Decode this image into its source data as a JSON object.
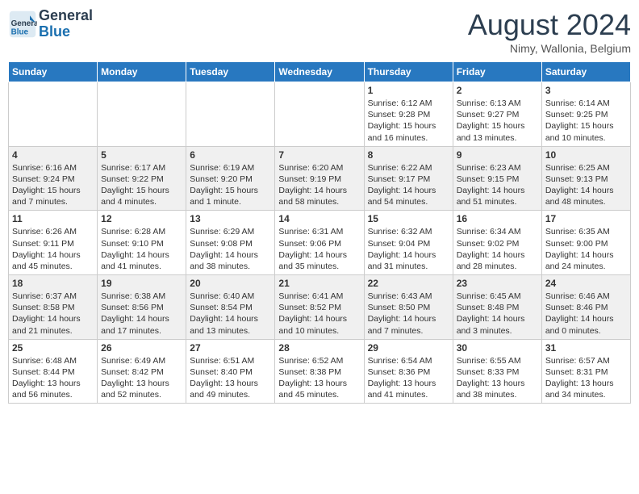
{
  "header": {
    "logo_line1": "General",
    "logo_line2": "Blue",
    "month_title": "August 2024",
    "location": "Nimy, Wallonia, Belgium"
  },
  "weekdays": [
    "Sunday",
    "Monday",
    "Tuesday",
    "Wednesday",
    "Thursday",
    "Friday",
    "Saturday"
  ],
  "weeks": [
    [
      {
        "day": "",
        "info": ""
      },
      {
        "day": "",
        "info": ""
      },
      {
        "day": "",
        "info": ""
      },
      {
        "day": "",
        "info": ""
      },
      {
        "day": "1",
        "info": "Sunrise: 6:12 AM\nSunset: 9:28 PM\nDaylight: 15 hours\nand 16 minutes."
      },
      {
        "day": "2",
        "info": "Sunrise: 6:13 AM\nSunset: 9:27 PM\nDaylight: 15 hours\nand 13 minutes."
      },
      {
        "day": "3",
        "info": "Sunrise: 6:14 AM\nSunset: 9:25 PM\nDaylight: 15 hours\nand 10 minutes."
      }
    ],
    [
      {
        "day": "4",
        "info": "Sunrise: 6:16 AM\nSunset: 9:24 PM\nDaylight: 15 hours\nand 7 minutes."
      },
      {
        "day": "5",
        "info": "Sunrise: 6:17 AM\nSunset: 9:22 PM\nDaylight: 15 hours\nand 4 minutes."
      },
      {
        "day": "6",
        "info": "Sunrise: 6:19 AM\nSunset: 9:20 PM\nDaylight: 15 hours\nand 1 minute."
      },
      {
        "day": "7",
        "info": "Sunrise: 6:20 AM\nSunset: 9:19 PM\nDaylight: 14 hours\nand 58 minutes."
      },
      {
        "day": "8",
        "info": "Sunrise: 6:22 AM\nSunset: 9:17 PM\nDaylight: 14 hours\nand 54 minutes."
      },
      {
        "day": "9",
        "info": "Sunrise: 6:23 AM\nSunset: 9:15 PM\nDaylight: 14 hours\nand 51 minutes."
      },
      {
        "day": "10",
        "info": "Sunrise: 6:25 AM\nSunset: 9:13 PM\nDaylight: 14 hours\nand 48 minutes."
      }
    ],
    [
      {
        "day": "11",
        "info": "Sunrise: 6:26 AM\nSunset: 9:11 PM\nDaylight: 14 hours\nand 45 minutes."
      },
      {
        "day": "12",
        "info": "Sunrise: 6:28 AM\nSunset: 9:10 PM\nDaylight: 14 hours\nand 41 minutes."
      },
      {
        "day": "13",
        "info": "Sunrise: 6:29 AM\nSunset: 9:08 PM\nDaylight: 14 hours\nand 38 minutes."
      },
      {
        "day": "14",
        "info": "Sunrise: 6:31 AM\nSunset: 9:06 PM\nDaylight: 14 hours\nand 35 minutes."
      },
      {
        "day": "15",
        "info": "Sunrise: 6:32 AM\nSunset: 9:04 PM\nDaylight: 14 hours\nand 31 minutes."
      },
      {
        "day": "16",
        "info": "Sunrise: 6:34 AM\nSunset: 9:02 PM\nDaylight: 14 hours\nand 28 minutes."
      },
      {
        "day": "17",
        "info": "Sunrise: 6:35 AM\nSunset: 9:00 PM\nDaylight: 14 hours\nand 24 minutes."
      }
    ],
    [
      {
        "day": "18",
        "info": "Sunrise: 6:37 AM\nSunset: 8:58 PM\nDaylight: 14 hours\nand 21 minutes."
      },
      {
        "day": "19",
        "info": "Sunrise: 6:38 AM\nSunset: 8:56 PM\nDaylight: 14 hours\nand 17 minutes."
      },
      {
        "day": "20",
        "info": "Sunrise: 6:40 AM\nSunset: 8:54 PM\nDaylight: 14 hours\nand 13 minutes."
      },
      {
        "day": "21",
        "info": "Sunrise: 6:41 AM\nSunset: 8:52 PM\nDaylight: 14 hours\nand 10 minutes."
      },
      {
        "day": "22",
        "info": "Sunrise: 6:43 AM\nSunset: 8:50 PM\nDaylight: 14 hours\nand 7 minutes."
      },
      {
        "day": "23",
        "info": "Sunrise: 6:45 AM\nSunset: 8:48 PM\nDaylight: 14 hours\nand 3 minutes."
      },
      {
        "day": "24",
        "info": "Sunrise: 6:46 AM\nSunset: 8:46 PM\nDaylight: 14 hours\nand 0 minutes."
      }
    ],
    [
      {
        "day": "25",
        "info": "Sunrise: 6:48 AM\nSunset: 8:44 PM\nDaylight: 13 hours\nand 56 minutes."
      },
      {
        "day": "26",
        "info": "Sunrise: 6:49 AM\nSunset: 8:42 PM\nDaylight: 13 hours\nand 52 minutes."
      },
      {
        "day": "27",
        "info": "Sunrise: 6:51 AM\nSunset: 8:40 PM\nDaylight: 13 hours\nand 49 minutes."
      },
      {
        "day": "28",
        "info": "Sunrise: 6:52 AM\nSunset: 8:38 PM\nDaylight: 13 hours\nand 45 minutes."
      },
      {
        "day": "29",
        "info": "Sunrise: 6:54 AM\nSunset: 8:36 PM\nDaylight: 13 hours\nand 41 minutes."
      },
      {
        "day": "30",
        "info": "Sunrise: 6:55 AM\nSunset: 8:33 PM\nDaylight: 13 hours\nand 38 minutes."
      },
      {
        "day": "31",
        "info": "Sunrise: 6:57 AM\nSunset: 8:31 PM\nDaylight: 13 hours\nand 34 minutes."
      }
    ]
  ]
}
